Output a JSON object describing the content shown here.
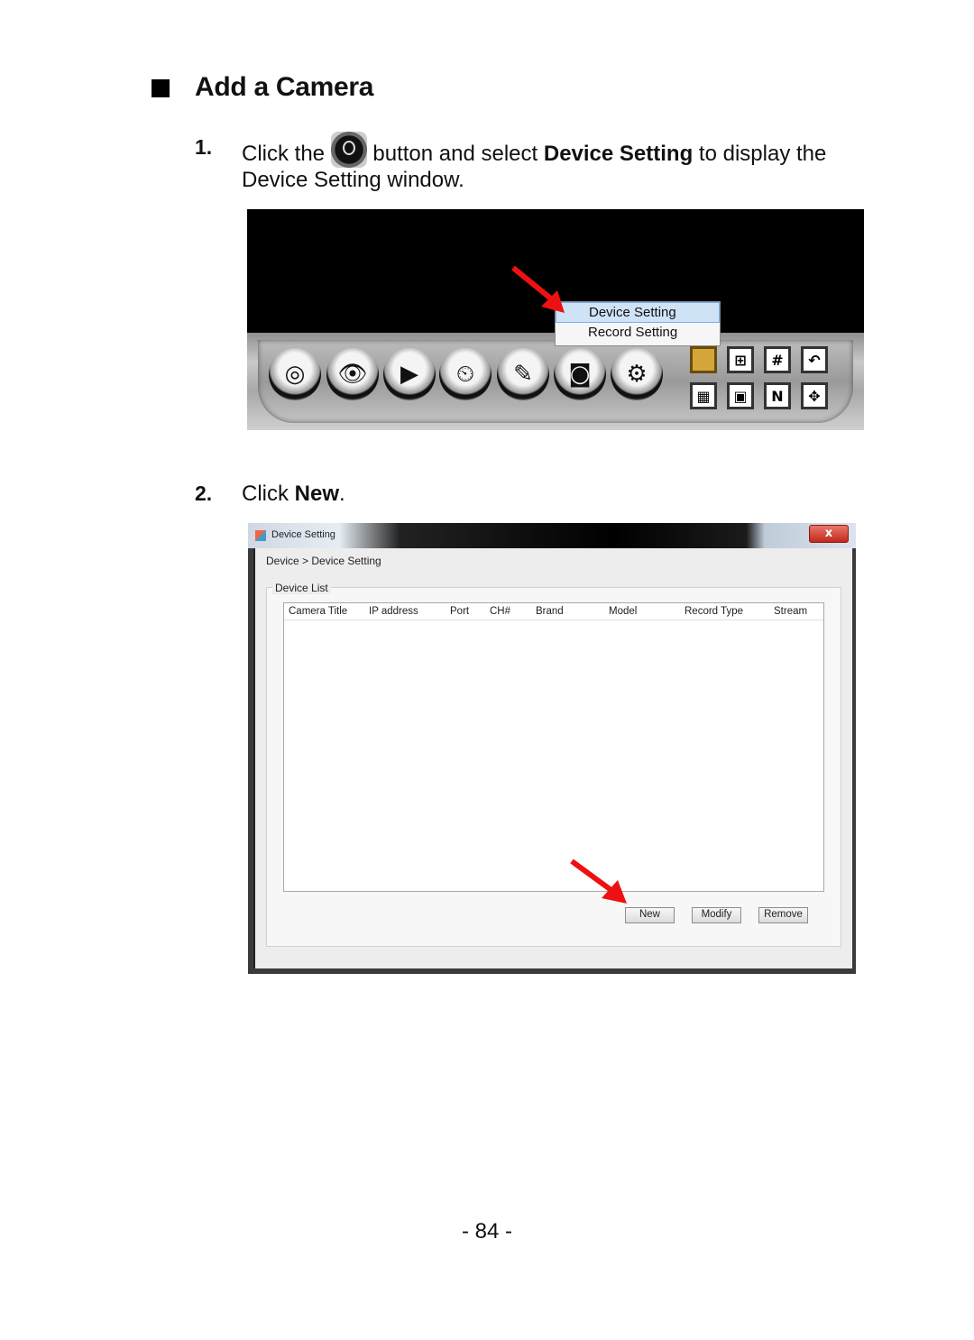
{
  "section": {
    "heading": "Add a Camera"
  },
  "steps": [
    {
      "number": "1.",
      "text_before_icon": "Click the",
      "icon": "device-setting-camera-icon",
      "text_after_icon": "button and select",
      "bold_text": "Device Setting",
      "text_end": "to display the",
      "line2": "Device Setting window."
    },
    {
      "number": "2.",
      "text_before": "Click",
      "bold_text": "New",
      "text_end": "."
    }
  ],
  "screenshot1": {
    "context_menu": {
      "items": [
        {
          "label": "Device Setting",
          "selected": true
        },
        {
          "label": "Record Setting",
          "selected": false
        }
      ]
    },
    "round_buttons": [
      {
        "icon": "record-icon",
        "glyph": "◎"
      },
      {
        "icon": "live-view-eye-icon",
        "glyph": "👁"
      },
      {
        "icon": "playback-icon",
        "glyph": "▶"
      },
      {
        "icon": "schedule-book-icon",
        "glyph": "⏲"
      },
      {
        "icon": "edit-pencil-icon",
        "glyph": "✎"
      },
      {
        "icon": "device-camera-icon",
        "glyph": "◙"
      },
      {
        "icon": "settings-gear-icon",
        "glyph": "⚙"
      }
    ],
    "layout_buttons": [
      {
        "icon": "layout-1-icon",
        "glyph": ""
      },
      {
        "icon": "layout-4-icon",
        "glyph": "⊞"
      },
      {
        "icon": "layout-9-icon",
        "glyph": "#"
      },
      {
        "icon": "rotate-icon",
        "glyph": "↶"
      },
      {
        "icon": "layout-13-icon",
        "glyph": "▦"
      },
      {
        "icon": "layout-16-icon",
        "glyph": "▣"
      },
      {
        "icon": "n-icon",
        "glyph": "N"
      },
      {
        "icon": "fullscreen-icon",
        "glyph": "✥"
      }
    ],
    "highlight_color": "#d4a63a",
    "arrow_color": "#ee1111"
  },
  "screenshot2": {
    "window_title": "Device Setting",
    "close_label": "x",
    "breadcrumb": "Device > Device Setting",
    "group_label": "Device List",
    "columns": [
      "Camera Title",
      "IP address",
      "Port",
      "CH#",
      "Brand",
      "Model",
      "Record Type",
      "Stream"
    ],
    "rows": [],
    "buttons": {
      "new": "New",
      "modify": "Modify",
      "remove": "Remove"
    }
  },
  "footer": {
    "page_number": "- 84 -"
  }
}
